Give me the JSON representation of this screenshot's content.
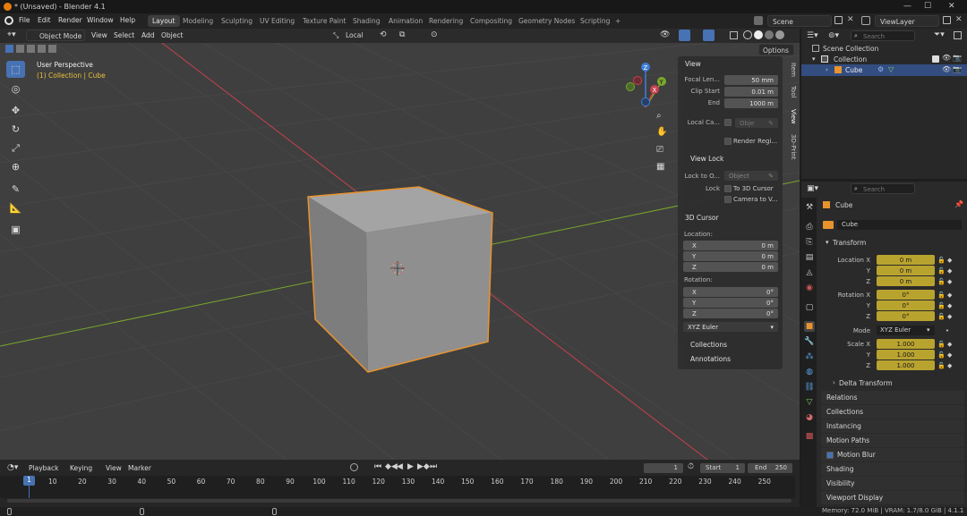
{
  "window": {
    "title": "* (Unsaved) - Blender 4.1",
    "minimize": "—",
    "maximize": "☐",
    "close": "✕"
  },
  "menu": [
    "File",
    "Edit",
    "Render",
    "Window",
    "Help"
  ],
  "workspaces": [
    "Layout",
    "Modeling",
    "Sculpting",
    "UV Editing",
    "Texture Paint",
    "Shading",
    "Animation",
    "Rendering",
    "Compositing",
    "Geometry Nodes",
    "Scripting",
    "+"
  ],
  "scene": {
    "scene_name": "Scene",
    "view_layer": "ViewLayer"
  },
  "viewport": {
    "mode": "Object Mode",
    "menus": [
      "View",
      "Select",
      "Add",
      "Object"
    ],
    "transform_orientation": "Local",
    "options": "Options",
    "overlay_title": "User Perspective",
    "overlay_collection": "(1) Collection | Cube",
    "side_tabs": [
      "Item",
      "Tool",
      "View",
      "3D-Print"
    ]
  },
  "npanel": {
    "view_header": "View",
    "focal_length_label": "Focal Len...",
    "focal_length": "50 mm",
    "clip_start_label": "Clip Start",
    "clip_start": "0.01 m",
    "clip_end_label": "End",
    "clip_end": "1000 m",
    "local_camera_label": "Local Ca...",
    "local_camera_value": "Obje",
    "render_region": "Render Regi...",
    "view_lock_header": "View Lock",
    "lock_to_object_label": "Lock to O...",
    "lock_to_object_value": "Object",
    "lock_label": "Lock",
    "to_3d_cursor": "To 3D Cursor",
    "camera_to_view": "Camera to V...",
    "cursor_header": "3D Cursor",
    "location_label": "Location:",
    "loc_x_label": "X",
    "loc_x": "0 m",
    "loc_y_label": "Y",
    "loc_y": "0 m",
    "loc_z_label": "Z",
    "loc_z": "0 m",
    "rotation_label": "Rotation:",
    "rot_x_label": "X",
    "rot_x": "0°",
    "rot_y_label": "Y",
    "rot_y": "0°",
    "rot_z_label": "Z",
    "rot_z": "0°",
    "rotation_mode": "XYZ Euler",
    "collections": "Collections",
    "annotations": "Annotations"
  },
  "outliner": {
    "search_placeholder": "Search",
    "scene_collection": "Scene Collection",
    "collection": "Collection",
    "cube": "Cube"
  },
  "properties": {
    "search_placeholder": "Search",
    "object_name": "Cube",
    "data_name": "Cube",
    "transform_header": "Transform",
    "location_x_label": "Location X",
    "location_x": "0 m",
    "location_y_label": "Y",
    "location_y": "0 m",
    "location_z_label": "Z",
    "location_z": "0 m",
    "rotation_x_label": "Rotation X",
    "rotation_x": "0°",
    "rotation_y_label": "Y",
    "rotation_y": "0°",
    "rotation_z_label": "Z",
    "rotation_z": "0°",
    "mode_label": "Mode",
    "mode": "XYZ Euler",
    "scale_x_label": "Scale X",
    "scale_x": "1.000",
    "scale_y_label": "Y",
    "scale_y": "1.000",
    "scale_z_label": "Z",
    "scale_z": "1.000",
    "delta_transform": "Delta Transform",
    "panels": [
      "Relations",
      "Collections",
      "Instancing",
      "Motion Paths",
      "Motion Blur",
      "Shading",
      "Visibility",
      "Viewport Display"
    ]
  },
  "timeline": {
    "menus": [
      "Playback",
      "Keying",
      "View",
      "Marker"
    ],
    "current_frame": "1",
    "start_label": "Start",
    "start": "1",
    "end_label": "End",
    "end": "250",
    "frame_badge": "1",
    "ticks": [
      "10",
      "20",
      "30",
      "40",
      "50",
      "60",
      "70",
      "80",
      "90",
      "100",
      "110",
      "120",
      "130",
      "140",
      "150",
      "160",
      "170",
      "180",
      "190",
      "200",
      "210",
      "220",
      "230",
      "240",
      "250"
    ]
  },
  "status": {
    "memory": "Memory: 72.0 MiB | VRAM: 1.7/8.0 GiB | 4.1.1"
  },
  "colors": {
    "selection": "#4772b3",
    "outline": "#e8932e",
    "field_yellow": "#b9a32f",
    "axis_x": "#c6414f",
    "axis_y": "#7ba72c",
    "axis_z": "#3d7dd6"
  }
}
